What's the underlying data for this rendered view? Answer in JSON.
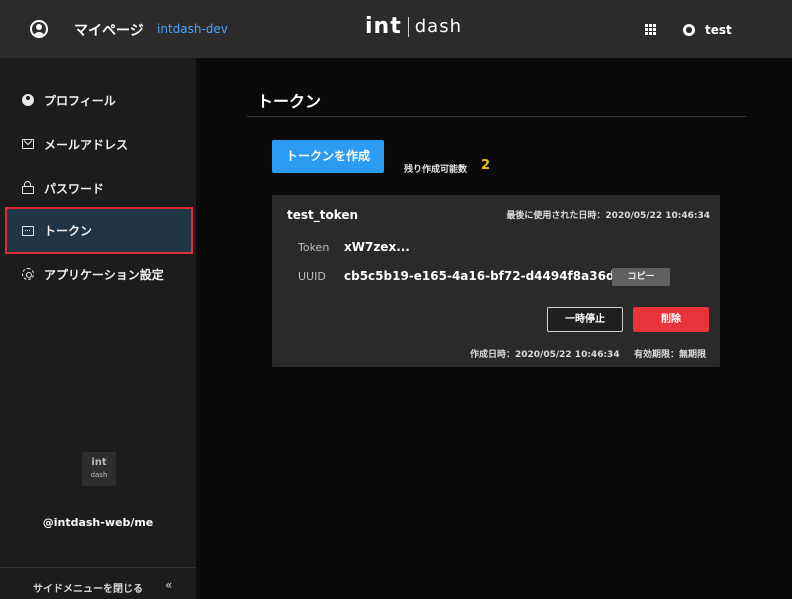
{
  "header": {
    "title": "マイページ",
    "subtitle": "intdash-dev",
    "brand_left": "int",
    "brand_right": "dash",
    "user_name": "test",
    "user_icon": "user-circle-icon",
    "apps_icon": "apps-grid-icon"
  },
  "sidebar": {
    "items": [
      {
        "label": "プロフィール",
        "icon": "profile-icon"
      },
      {
        "label": "メールアドレス",
        "icon": "mail-icon"
      },
      {
        "label": "パスワード",
        "icon": "lock-icon"
      },
      {
        "label": "トークン",
        "icon": "token-icon",
        "active": true
      },
      {
        "label": "アプリケーション設定",
        "icon": "gear-icon"
      }
    ],
    "logo_top": "int",
    "logo_bottom": "dash",
    "app_name": "@intdash-web/me",
    "close_label": "サイドメニューを閉じる",
    "close_icon": "«"
  },
  "main": {
    "title": "トークン",
    "create_button": "トークンを作成",
    "remaining_label": "残り作成可能数",
    "remaining_count": "2",
    "token": {
      "name": "test_token",
      "last_used": "最後に使用された日時：2020/05/22 10:46:34",
      "token_label": "Token",
      "token_value": "xW7zex...",
      "uuid_label": "UUID",
      "uuid_value": "cb5c5b19-e165-4a16-bf72-d4494f8a36df",
      "copy_button": "コピー",
      "suspend_button": "一時停止",
      "delete_button": "削除",
      "created_at": "作成日時：2020/05/22 10:46:34",
      "expiry": "有効期限：無期限"
    }
  },
  "colors": {
    "accent_blue": "#2b9cf2",
    "delete_red": "#e8333b",
    "count_yellow": "#f4c20d",
    "subtitle_blue": "#4aa3ff",
    "active_border": "#e02a35"
  }
}
